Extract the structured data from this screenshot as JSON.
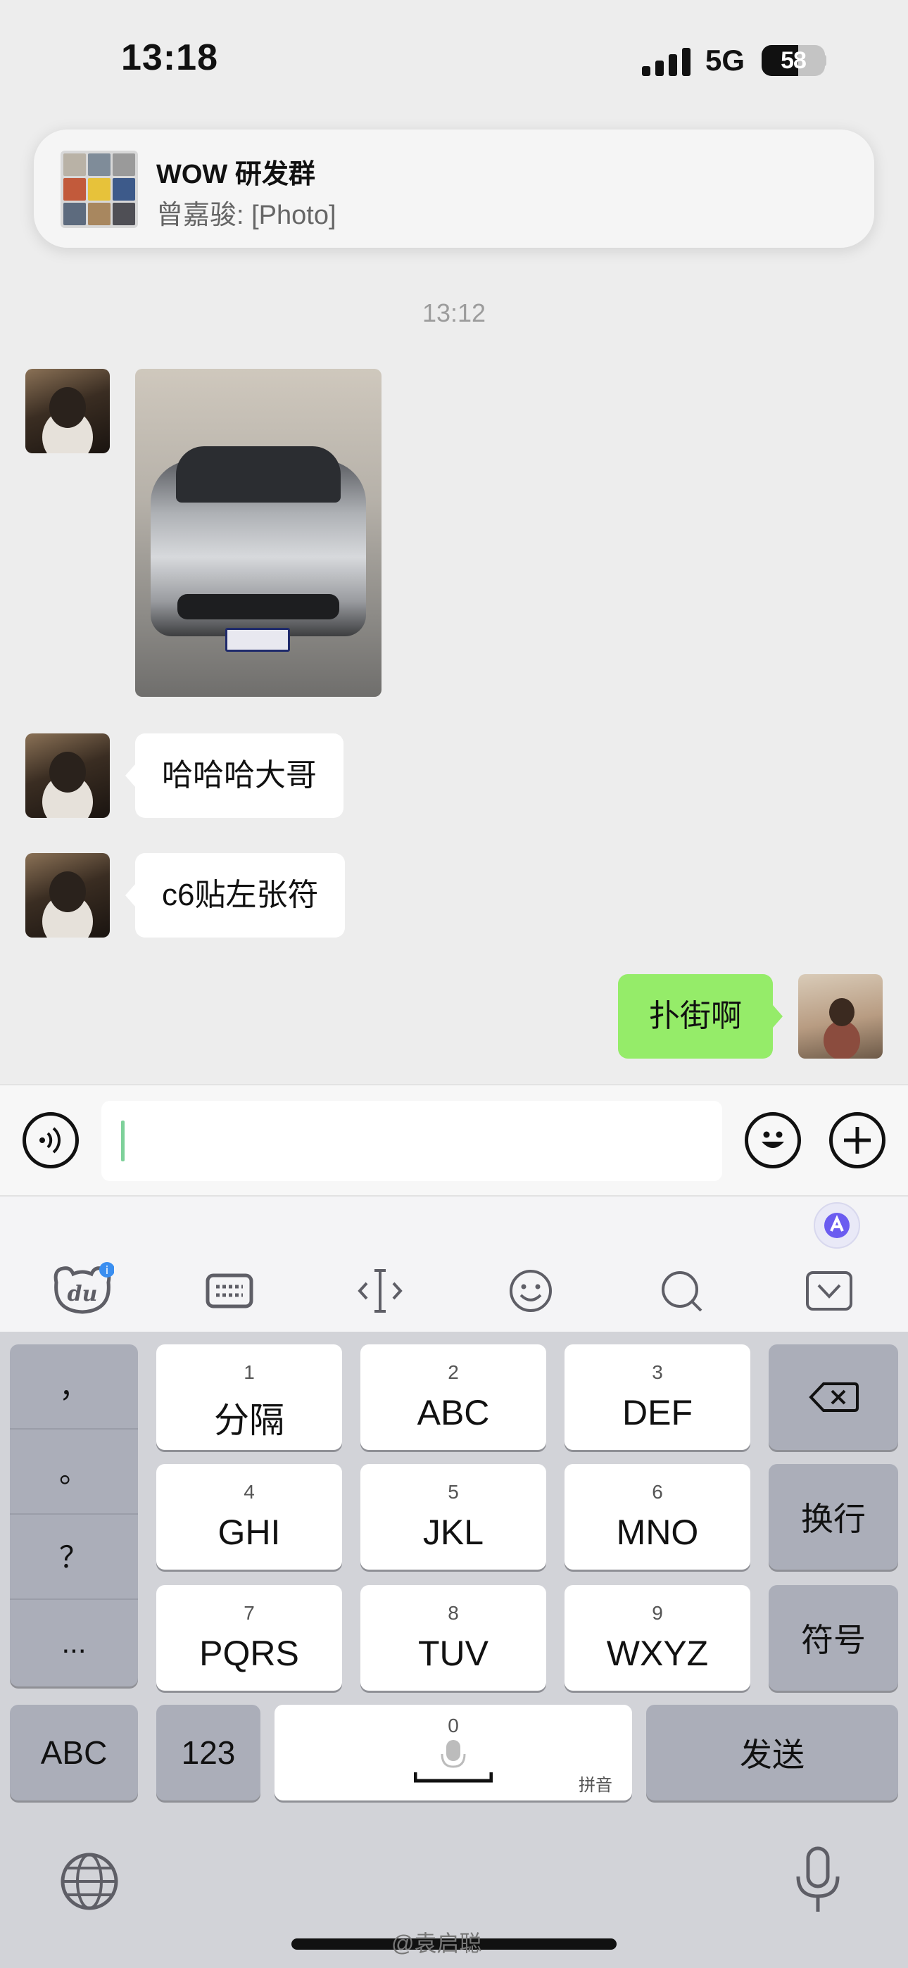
{
  "status_bar": {
    "time": "13:18",
    "network": "5G",
    "battery": "58",
    "battery_level": 0.58
  },
  "notification": {
    "title": "WOW 研发群",
    "subtitle": "曾嘉骏: [Photo]"
  },
  "chat": {
    "timestamp": "13:12",
    "messages": [
      {
        "sender": "other",
        "type": "image",
        "alt": "car-photo"
      },
      {
        "sender": "other",
        "type": "text",
        "text": "哈哈哈大哥"
      },
      {
        "sender": "other",
        "type": "text",
        "text": "c6贴左张符"
      },
      {
        "sender": "me",
        "type": "text",
        "text": "扑街啊"
      }
    ]
  },
  "input_bar": {
    "value": "",
    "voice_icon": "voice-icon",
    "emoji_icon": "emoji-icon",
    "plus_icon": "plus-icon"
  },
  "keyboard": {
    "toolbar_icons": [
      "du-logo-icon",
      "keyboard-icon",
      "cursor-icon",
      "smiley-icon",
      "search-icon",
      "collapse-keyboard-icon"
    ],
    "punctuation": [
      "，",
      "。",
      "？",
      "..."
    ],
    "keys": [
      {
        "num": "1",
        "label": "分隔"
      },
      {
        "num": "2",
        "label": "ABC"
      },
      {
        "num": "3",
        "label": "DEF"
      },
      {
        "num": "4",
        "label": "GHI"
      },
      {
        "num": "5",
        "label": "JKL"
      },
      {
        "num": "6",
        "label": "MNO"
      },
      {
        "num": "7",
        "label": "PQRS"
      },
      {
        "num": "8",
        "label": "TUV"
      },
      {
        "num": "9",
        "label": "WXYZ"
      }
    ],
    "right_keys": {
      "newline": "换行",
      "symbols": "符号",
      "send": "发送"
    },
    "bottom_keys": {
      "abc": "ABC",
      "num": "123",
      "space_num": "0",
      "space_hint": "拼音"
    }
  },
  "watermark": "@袁启聪",
  "colors": {
    "outgoing_bubble": "#95ec69",
    "incoming_bubble": "#ffffff",
    "background": "#ededed"
  }
}
